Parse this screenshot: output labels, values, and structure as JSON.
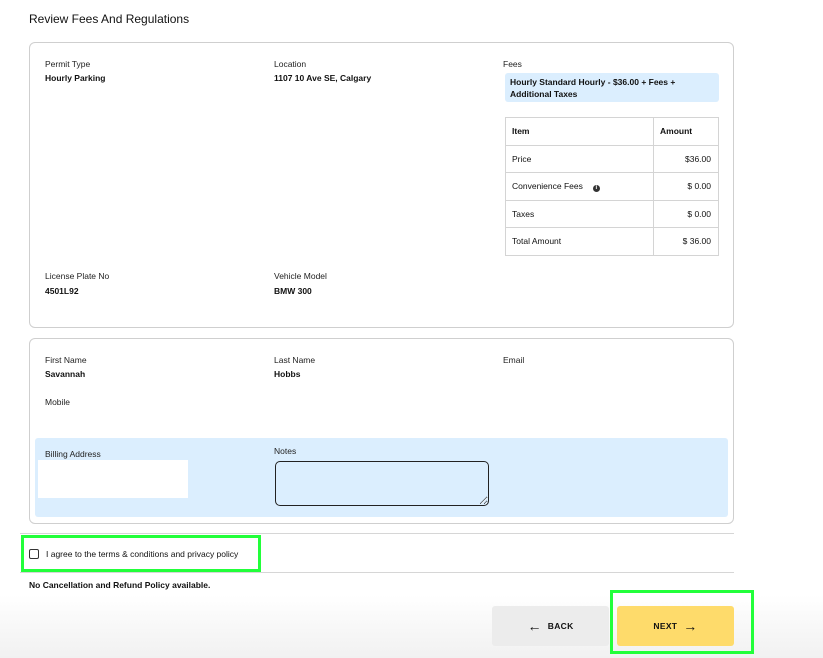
{
  "page": {
    "title": "Review Fees And Regulations"
  },
  "permit": {
    "permit_type_label": "Permit Type",
    "permit_type_value": "Hourly Parking",
    "location_label": "Location",
    "location_value": "1107 10 Ave SE, Calgary",
    "fees_label": "Fees",
    "fees_summary": "Hourly Standard Hourly - $36.00 + Fees + Additional Taxes",
    "license_plate_label": "License Plate No",
    "license_plate_value": "4501L92",
    "vehicle_model_label": "Vehicle Model",
    "vehicle_model_value": "BMW 300"
  },
  "fee_table": {
    "headers": [
      "Item",
      "Amount"
    ],
    "rows": [
      {
        "item": "Price",
        "amount": "$36.00"
      },
      {
        "item": "Convenience Fees",
        "amount": "$ 0.00",
        "icon": "info-icon"
      },
      {
        "item": "Taxes",
        "amount": "$ 0.00"
      },
      {
        "item": "Total Amount",
        "amount": "$ 36.00"
      }
    ]
  },
  "contact": {
    "first_name_label": "First Name",
    "first_name_value": "Savannah",
    "last_name_label": "Last Name",
    "last_name_value": "Hobbs",
    "email_label": "Email",
    "email_value": "",
    "mobile_label": "Mobile",
    "mobile_value": "",
    "billing_address_label": "Billing Address",
    "notes_label": "Notes",
    "notes_value": ""
  },
  "agreement": {
    "label": "I agree to the terms & conditions and privacy policy",
    "checked": false
  },
  "policy_text": "No Cancellation and Refund Policy available.",
  "buttons": {
    "back": "BACK",
    "next": "NEXT"
  },
  "colors": {
    "highlight": "#22ff3a",
    "next_button": "#fedb6b",
    "back_button": "#ececec",
    "info_band": "#dbeefe"
  }
}
